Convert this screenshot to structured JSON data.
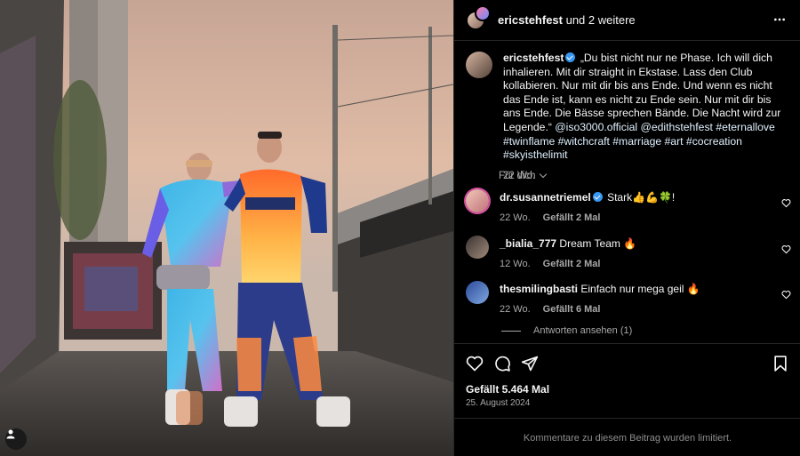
{
  "header": {
    "username": "ericstehfest",
    "suffix": " und 2 weitere",
    "more_icon": "more-horizontal-icon"
  },
  "caption": {
    "username": "ericstehfest",
    "text": "„Du bist nicht nur ne Phase. Ich will dich inhalieren. Mit dir straight in Ekstase. Lass den Club kollabieren. Nur mit dir bis ans Ende. Und wenn es nicht das Ende ist, kann es nicht zu Ende sein. Nur mit dir bis ans Ende. Die Bässe sprechen Bände. Die Nacht wird zur Legende.“ ",
    "mention": "@iso3000.official",
    "tags": "@edithstehfest #eternallove #twinflame #witchcraft #marriage #art #cocreation #skyisthelimit",
    "age": "22 Wo."
  },
  "fuer_dich": "Für dich",
  "comments": [
    {
      "username": "dr.susannetriemel",
      "verified": true,
      "text": "Stark👍💪🍀!",
      "age": "22 Wo.",
      "likes": "Gefällt 2 Mal"
    },
    {
      "username": "_bialia_777",
      "verified": false,
      "text": "Dream Team 🔥",
      "age": "12 Wo.",
      "likes": "Gefällt 2 Mal"
    },
    {
      "username": "thesmilingbasti",
      "verified": false,
      "text": "Einfach nur mega geil 🔥",
      "age": "22 Wo.",
      "likes": "Gefällt 6 Mal"
    }
  ],
  "replies_label": "Antworten ansehen (1)",
  "actions": {
    "like_icon": "heart-icon",
    "comment_icon": "comment-icon",
    "share_icon": "share-icon",
    "save_icon": "bookmark-icon"
  },
  "likes_total": "Gefällt 5.464 Mal",
  "post_date": "25. August 2024",
  "comments_limited": "Kommentare zu diesem Beitrag wurden limitiert.",
  "colors": {
    "background": "#000000",
    "divider": "#262626",
    "secondary_text": "#a8a8a8",
    "verified": "#3897f0"
  }
}
